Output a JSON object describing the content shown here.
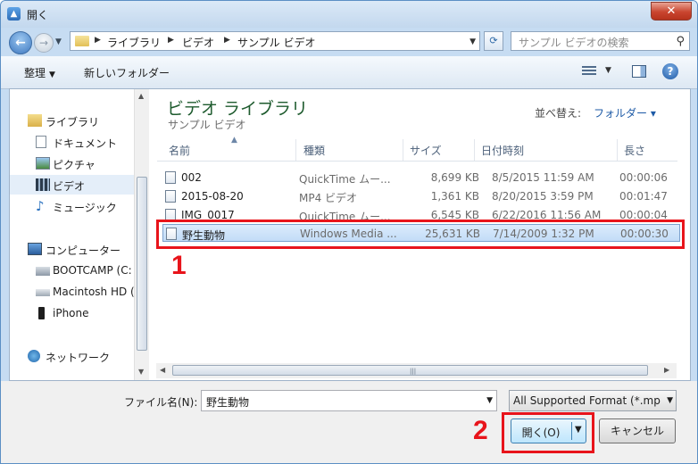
{
  "window": {
    "title": "開く",
    "close_glyph": "✕"
  },
  "address": {
    "crumbs": [
      "ライブラリ",
      "ビデオ",
      "サンプル ビデオ"
    ],
    "search_placeholder": "サンプル ビデオの検索"
  },
  "toolbar": {
    "organize": "整理",
    "new_folder": "新しいフォルダー"
  },
  "nav": {
    "items": [
      {
        "label": "ライブラリ",
        "icon": "library-icon"
      },
      {
        "label": "ドキュメント",
        "icon": "documents-icon"
      },
      {
        "label": "ピクチャ",
        "icon": "pictures-icon"
      },
      {
        "label": "ビデオ",
        "icon": "video-icon"
      },
      {
        "label": "ミュージック",
        "icon": "music-icon"
      },
      {
        "label": "コンピューター",
        "icon": "computer-icon"
      },
      {
        "label": "BOOTCAMP (C:",
        "icon": "drive-icon"
      },
      {
        "label": "Macintosh HD (",
        "icon": "drive-icon"
      },
      {
        "label": "iPhone",
        "icon": "phone-icon"
      },
      {
        "label": "ネットワーク",
        "icon": "network-icon"
      }
    ]
  },
  "library": {
    "title": "ビデオ ライブラリ",
    "subtitle": "サンプル ビデオ",
    "arrange_label": "並べ替え:",
    "arrange_value": "フォルダー ▾"
  },
  "columns": {
    "name": "名前",
    "type": "種類",
    "size": "サイズ",
    "date": "日付時刻",
    "length": "長さ"
  },
  "files": [
    {
      "name": "002",
      "type": "QuickTime ムー...",
      "size": "8,699 KB",
      "date": "8/5/2015 11:59 AM",
      "length": "00:00:06"
    },
    {
      "name": "2015-08-20",
      "type": "MP4 ビデオ",
      "size": "1,361 KB",
      "date": "8/20/2015 3:59 PM",
      "length": "00:01:47"
    },
    {
      "name": "IMG_0017",
      "type": "QuickTime ムー...",
      "size": "6,545 KB",
      "date": "6/22/2016 11:56 AM",
      "length": "00:00:04"
    },
    {
      "name": "野生動物",
      "type": "Windows Media ...",
      "size": "25,631 KB",
      "date": "7/14/2009 1:32 PM",
      "length": "00:00:30"
    }
  ],
  "bottom": {
    "filename_label": "ファイル名(N):",
    "filename_value": "野生動物",
    "filter_value": "All Supported Format (*.mp",
    "open_label": "開く(O)",
    "cancel_label": "キャンセル"
  },
  "annotations": {
    "step1": "1",
    "step2": "2",
    "color": "#e8141b"
  }
}
